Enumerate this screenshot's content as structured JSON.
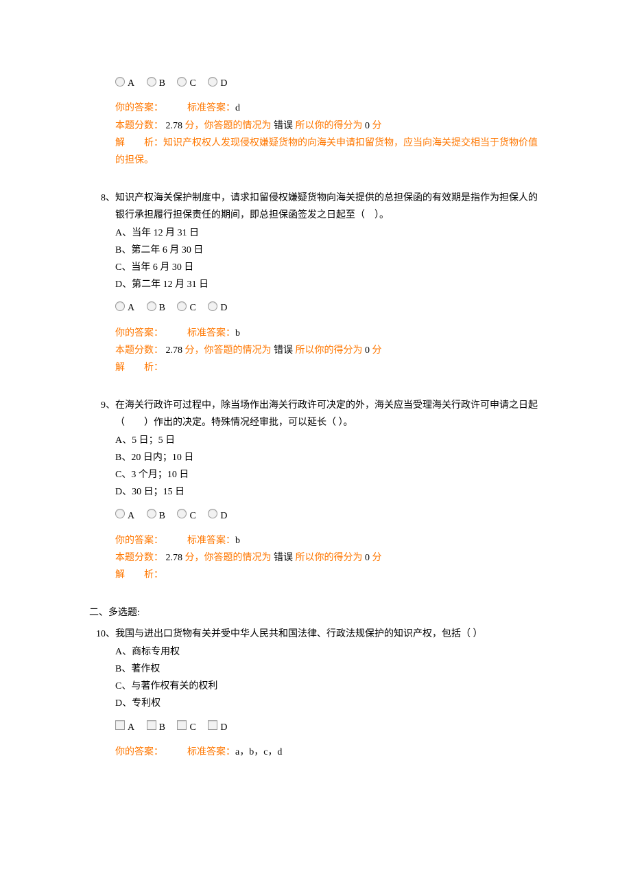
{
  "q7_tail": {
    "radios": [
      "A",
      "B",
      "C",
      "D"
    ],
    "your_answer_label": "你的答案：",
    "std_answer_label": "标准答案：",
    "std_answer": "d",
    "score_label": "本题分数：",
    "score_val": "2.78",
    "score_unit": "分，你答题的情况为",
    "status": "错误",
    "so_label": "所以你的得分为",
    "got_score": "0",
    "got_unit": "分",
    "analysis_label": "解　　析：",
    "analysis": "知识产权权人发现侵权嫌疑货物的向海关申请扣留货物，应当向海关提交相当于货物价值的担保。"
  },
  "q8": {
    "num": "8、",
    "stem": "知识产权海关保护制度中，请求扣留侵权嫌疑货物向海关提供的总担保函的有效期是指作为担保人的银行承担履行担保责任的期间，即总担保函签发之日起至（　）。",
    "opts": [
      "A、当年 12 月 31 日",
      "B、第二年 6 月 30 日",
      "C、当年 6 月 30 日",
      "D、第二年 12 月 31 日"
    ],
    "radios": [
      "A",
      "B",
      "C",
      "D"
    ],
    "your_answer_label": "你的答案：",
    "std_answer_label": "标准答案：",
    "std_answer": "b",
    "score_label": "本题分数：",
    "score_val": "2.78",
    "score_unit": "分，你答题的情况为",
    "status": "错误",
    "so_label": "所以你的得分为",
    "got_score": "0",
    "got_unit": "分",
    "analysis_label": "解　　析："
  },
  "q9": {
    "num": "9、",
    "stem": "在海关行政许可过程中，除当场作出海关行政许可决定的外，海关应当受理海关行政许可申请之日起（　　）作出的决定。特殊情况经审批，可以延长（ ）。",
    "opts": [
      "A、5 日；5 日",
      "B、20 日内；10 日",
      "C、3 个月；10 日",
      "D、30 日；15 日"
    ],
    "radios": [
      "A",
      "B",
      "C",
      "D"
    ],
    "your_answer_label": "你的答案：",
    "std_answer_label": "标准答案：",
    "std_answer": "b",
    "score_label": "本题分数：",
    "score_val": "2.78",
    "score_unit": "分，你答题的情况为",
    "status": "错误",
    "so_label": "所以你的得分为",
    "got_score": "0",
    "got_unit": "分",
    "analysis_label": "解　　析："
  },
  "section2": "二、多选题:",
  "q10": {
    "num": "10、",
    "stem": "我国与进出口货物有关并受中华人民共和国法律、行政法规保护的知识产权，包括（ ）",
    "opts": [
      "A、商标专用权",
      "B、著作权",
      "C、与著作权有关的权利",
      "D、专利权"
    ],
    "radios": [
      "A",
      "B",
      "C",
      "D"
    ],
    "your_answer_label": "你的答案：",
    "std_answer_label": "标准答案：",
    "std_answer": "a，b，c，d"
  }
}
